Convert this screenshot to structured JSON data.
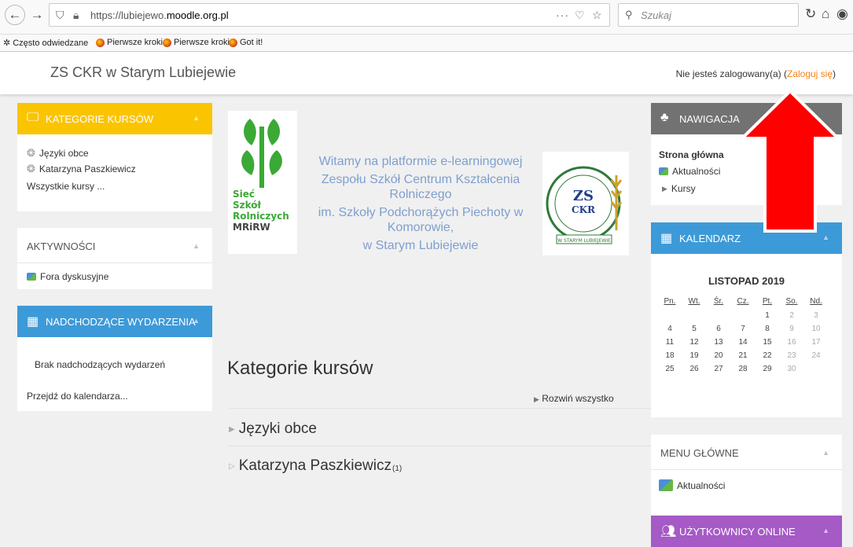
{
  "browser": {
    "url_prefix": "https://lubiejewo.",
    "url_domain": "moodle.org.pl",
    "more_icon": "three-dots-icon",
    "search_placeholder": "Szukaj"
  },
  "bookmarks": [
    {
      "label": "Często odwiedzane",
      "icon": "gear-icon"
    },
    {
      "label": "Pierwsze kroki",
      "icon": "firefox-icon"
    },
    {
      "label": "Pierwsze kroki",
      "icon": "firefox-icon"
    },
    {
      "label": "Got it!",
      "icon": "firefox-icon"
    }
  ],
  "header": {
    "site_name": "ZS CKR w Starym Lubiejewie",
    "login_text": "Nie jesteś zalogowany(a) (",
    "login_link": "Zaloguj się",
    "login_close": ")"
  },
  "left": {
    "categories": {
      "title": "KATEGORIE KURSÓW",
      "items": [
        "Języki obce",
        "Katarzyna Paszkiewicz"
      ],
      "all_courses": "Wszystkie kursy ..."
    },
    "activities": {
      "title": "AKTYWNOŚCI",
      "items": [
        "Fora dyskusyjne"
      ]
    },
    "events": {
      "title": "NADCHODZĄCE WYDARZENIA",
      "empty": "Brak nadchodzących wydarzeń",
      "goto": "Przejdź do kalendarza..."
    }
  },
  "main": {
    "welcome": [
      "Witamy na platformie e-learningowej",
      "Zespołu Szkół Centrum Kształcenia Rolniczego",
      "im. Szkoły Podchorążych Piechoty w Komorowie,",
      "w Starym Lubiejewie"
    ],
    "logo_left_text": [
      "Sieć",
      "Szkół",
      "Rolniczych",
      "MRiRW"
    ],
    "logo_right_text": [
      "ZS",
      "CKR",
      "W STARYM LUBIEJEWIE"
    ],
    "title": "Kategorie kursów",
    "expand_all": "Rozwiń wszystko",
    "categories": [
      {
        "label": "Języki obce",
        "count": ""
      },
      {
        "label": "Katarzyna Paszkiewicz",
        "count": "(1)"
      }
    ]
  },
  "right": {
    "navigation": {
      "title": "NAWIGACJA",
      "home": "Strona główna",
      "news": "Aktualności",
      "courses": "Kursy"
    },
    "calendar": {
      "title": "KALENDARZ",
      "month": "LISTOPAD 2019",
      "weekdays": [
        "Pn.",
        "Wt.",
        "Śr.",
        "Cz.",
        "Pt.",
        "So.",
        "Nd."
      ],
      "weeks": [
        [
          "",
          "",
          "",
          "",
          "1",
          "2",
          "3"
        ],
        [
          "4",
          "5",
          "6",
          "7",
          "8",
          "9",
          "10"
        ],
        [
          "11",
          "12",
          "13",
          "14",
          "15",
          "16",
          "17"
        ],
        [
          "18",
          "19",
          "20",
          "21",
          "22",
          "23",
          "24"
        ],
        [
          "25",
          "26",
          "27",
          "28",
          "29",
          "30",
          ""
        ]
      ]
    },
    "main_menu": {
      "title": "MENU GŁÓWNE",
      "items": [
        "Aktualności"
      ]
    },
    "online": {
      "title": "UŻYTKOWNICY ONLINE"
    }
  },
  "colors": {
    "accent": "#f98012",
    "yellow": "#fbc400",
    "blue": "#3d9ad8",
    "gray": "#727272",
    "purple": "#a55ac6",
    "arrow": "#ff0000"
  }
}
